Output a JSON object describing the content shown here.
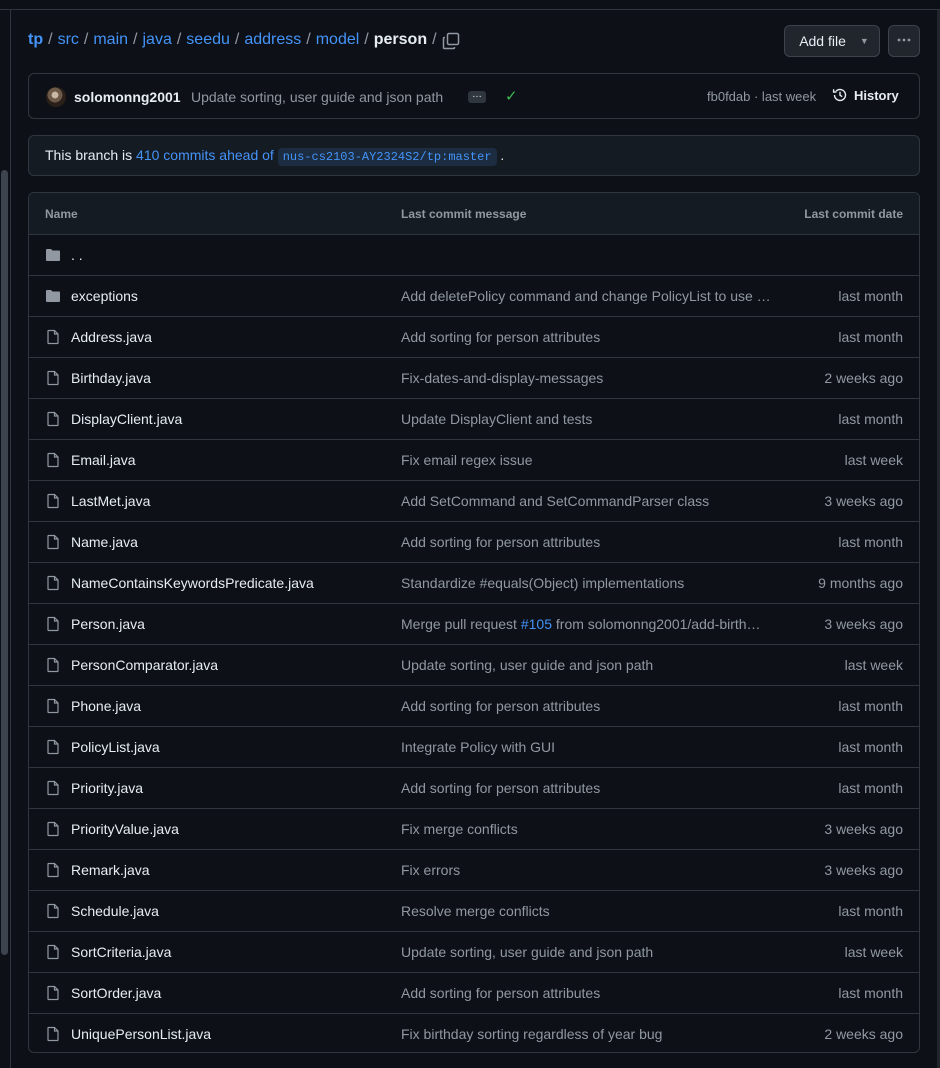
{
  "breadcrumb": {
    "items": [
      "tp",
      "src",
      "main",
      "java",
      "seedu",
      "address",
      "model"
    ],
    "current": "person",
    "separator": "/"
  },
  "toolbar": {
    "add_file_label": "Add file",
    "more_icon": "kebab-horizontal-icon"
  },
  "commit": {
    "author": "solomonng2001",
    "message": "Update sorting, user guide and json path",
    "sha_text": "fb0fdab · last week",
    "history_label": "History",
    "status_color": "#3fb950"
  },
  "branch": {
    "prefix": "This branch is ",
    "ahead_text": "410 commits ahead of",
    "base": "nus-cs2103-AY2324S2/tp:master",
    "suffix": "."
  },
  "table": {
    "headers": {
      "name": "Name",
      "message": "Last commit message",
      "date": "Last commit date"
    },
    "parent_label": ". .",
    "rows": [
      {
        "type": "folder",
        "name": "exceptions",
        "message": "Add deletePolicy command and change PolicyList to use …",
        "date": "last month"
      },
      {
        "type": "file",
        "name": "Address.java",
        "message": "Add sorting for person attributes",
        "date": "last month"
      },
      {
        "type": "file",
        "name": "Birthday.java",
        "message": "Fix-dates-and-display-messages",
        "date": "2 weeks ago"
      },
      {
        "type": "file",
        "name": "DisplayClient.java",
        "message": "Update DisplayClient and tests",
        "date": "last month"
      },
      {
        "type": "file",
        "name": "Email.java",
        "message": "Fix email regex issue",
        "date": "last week"
      },
      {
        "type": "file",
        "name": "LastMet.java",
        "message": "Add SetCommand and SetCommandParser class",
        "date": "3 weeks ago"
      },
      {
        "type": "file",
        "name": "Name.java",
        "message": "Add sorting for person attributes",
        "date": "last month"
      },
      {
        "type": "file",
        "name": "NameContainsKeywordsPredicate.java",
        "message": "Standardize #equals(Object) implementations",
        "date": "9 months ago"
      },
      {
        "type": "file",
        "name": "Person.java",
        "message_pre": "Merge pull request ",
        "message_link": "#105",
        "message_post": " from solomonng2001/add-birth…",
        "date": "3 weeks ago"
      },
      {
        "type": "file",
        "name": "PersonComparator.java",
        "message": "Update sorting, user guide and json path",
        "date": "last week"
      },
      {
        "type": "file",
        "name": "Phone.java",
        "message": "Add sorting for person attributes",
        "date": "last month"
      },
      {
        "type": "file",
        "name": "PolicyList.java",
        "message": "Integrate Policy with GUI",
        "date": "last month"
      },
      {
        "type": "file",
        "name": "Priority.java",
        "message": "Add sorting for person attributes",
        "date": "last month"
      },
      {
        "type": "file",
        "name": "PriorityValue.java",
        "message": "Fix merge conflicts",
        "date": "3 weeks ago"
      },
      {
        "type": "file",
        "name": "Remark.java",
        "message": "Fix errors",
        "date": "3 weeks ago"
      },
      {
        "type": "file",
        "name": "Schedule.java",
        "message": "Resolve merge conflicts",
        "date": "last month"
      },
      {
        "type": "file",
        "name": "SortCriteria.java",
        "message": "Update sorting, user guide and json path",
        "date": "last week"
      },
      {
        "type": "file",
        "name": "SortOrder.java",
        "message": "Add sorting for person attributes",
        "date": "last month"
      },
      {
        "type": "file",
        "name": "UniquePersonList.java",
        "message": "Fix birthday sorting regardless of year bug",
        "date": "2 weeks ago"
      }
    ]
  }
}
